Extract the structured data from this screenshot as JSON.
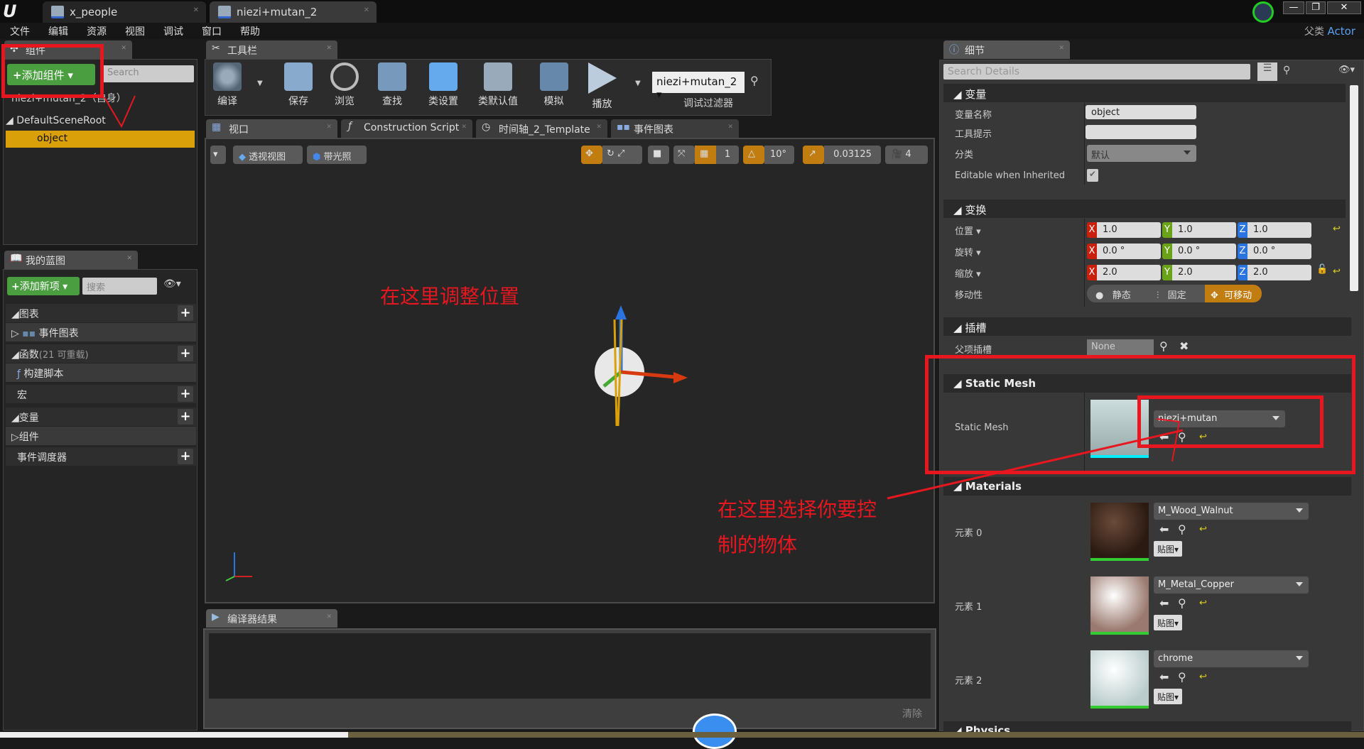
{
  "app": {
    "logo": "unreal-logo",
    "parent_class_label": "父类",
    "parent_class": "Actor"
  },
  "doc_tabs": [
    {
      "label": "x_people"
    },
    {
      "label": "niezi+mutan_2"
    }
  ],
  "menu": [
    "文件",
    "编辑",
    "资源",
    "视图",
    "调试",
    "窗口",
    "帮助"
  ],
  "components": {
    "tab": "组件",
    "add_button": "添加组件",
    "search_placeholder": "Search",
    "tree": [
      {
        "label": "niezi+mutan_2（自身）"
      },
      {
        "label": "DefaultSceneRoot"
      },
      {
        "label": "object",
        "selected": true
      }
    ]
  },
  "blueprint": {
    "tab": "我的蓝图",
    "add_button": "添加新项",
    "search_placeholder": "搜索",
    "sections": [
      {
        "label": "图表"
      },
      {
        "label": "事件图表"
      },
      {
        "label": "函数",
        "note": "(21 可重载)"
      },
      {
        "label": "构建脚本"
      },
      {
        "label": "宏"
      },
      {
        "label": "变量"
      },
      {
        "label": "组件"
      },
      {
        "label": "事件调度器"
      }
    ]
  },
  "toolbar": {
    "tab": "工具栏",
    "buttons": [
      "编译",
      "保存",
      "浏览",
      "查找",
      "类设置",
      "类默认值",
      "模拟",
      "播放"
    ],
    "debug_object": "niezi+mutan_2",
    "debug_filter_label": "调试过滤器"
  },
  "editor_tabs": [
    {
      "label": "视口"
    },
    {
      "label": "Construction Script"
    },
    {
      "label": "时间轴_2_Template"
    },
    {
      "label": "事件图表"
    }
  ],
  "viewport": {
    "perspective": "透视视图",
    "lit": "带光照",
    "grid_snap": "1",
    "rotation_snap": "10°",
    "scale_snap": "0.03125",
    "camera_speed": "4"
  },
  "compiler": {
    "tab": "编译器结果",
    "clear": "清除"
  },
  "details": {
    "tab": "细节",
    "search_placeholder": "Search Details",
    "variable": {
      "title": "变量",
      "name_label": "变量名称",
      "name_value": "object",
      "tooltip_label": "工具提示",
      "tooltip_value": "",
      "category_label": "分类",
      "category_value": "默认",
      "editable_label": "Editable when Inherited",
      "editable_checked": true
    },
    "transform": {
      "title": "变换",
      "location_label": "位置",
      "location": [
        "1.0",
        "1.0",
        "1.0"
      ],
      "rotation_label": "旋转",
      "rotation": [
        "0.0 °",
        "0.0 °",
        "0.0 °"
      ],
      "scale_label": "缩放",
      "scale": [
        "2.0",
        "2.0",
        "2.0"
      ],
      "mobility_label": "移动性",
      "mobility": [
        "静态",
        "固定",
        "可移动"
      ],
      "mobility_selected": "可移动"
    },
    "sockets": {
      "title": "插槽",
      "parent_label": "父项插槽",
      "parent_value": "None"
    },
    "static_mesh": {
      "title": "Static Mesh",
      "label": "Static Mesh",
      "value": "niezi+mutan"
    },
    "materials": {
      "title": "Materials",
      "texture_button": "贴图",
      "elements": [
        {
          "label": "元素 0",
          "value": "M_Wood_Walnut"
        },
        {
          "label": "元素 1",
          "value": "M_Metal_Copper"
        },
        {
          "label": "元素 2",
          "value": "chrome"
        }
      ]
    },
    "physics_title": "Physics"
  },
  "annotations": {
    "viewport_note": "在这里调整位置",
    "mesh_note_1": "在这里选择你要控",
    "mesh_note_2": "制的物体"
  },
  "colors": {
    "accent": "#c17d10",
    "selected": "#d9a00a",
    "add_green": "#4a9e40",
    "annotation_red": "#e8161f",
    "axis_x": "#c8200c",
    "axis_y": "#6aa318",
    "axis_z": "#2a74e0"
  }
}
